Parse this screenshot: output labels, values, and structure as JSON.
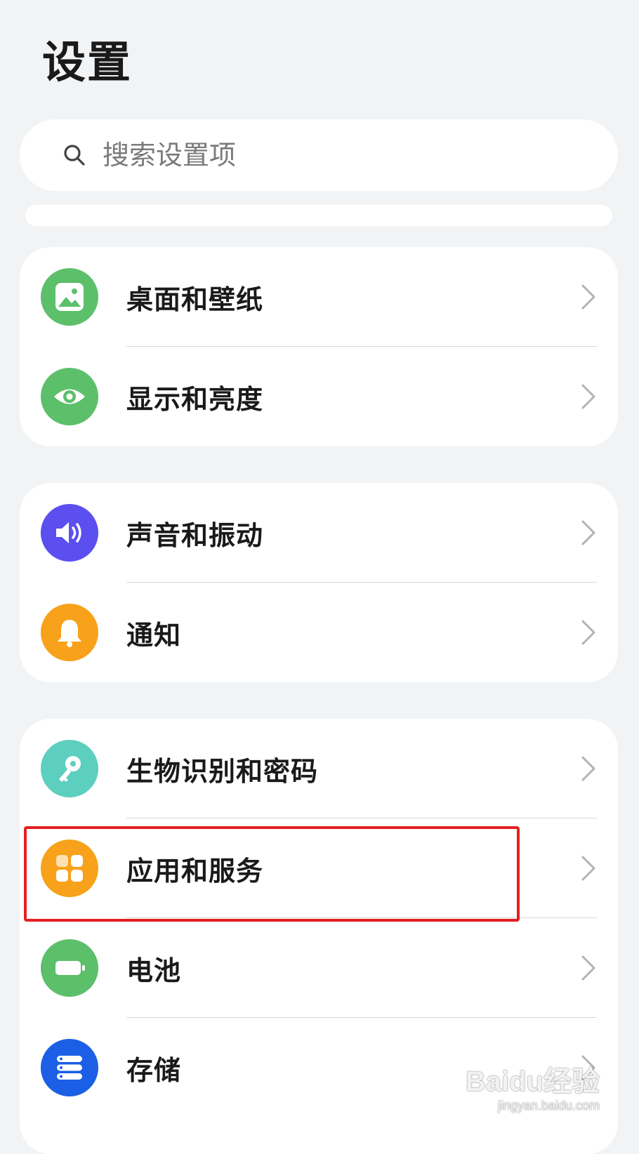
{
  "header": {
    "title": "设置"
  },
  "search": {
    "placeholder": "搜索设置项",
    "icon": "search-icon"
  },
  "groups": [
    {
      "items": [
        {
          "label": "桌面和壁纸",
          "icon": "wallpaper-icon",
          "color": "#5cbf6a"
        },
        {
          "label": "显示和亮度",
          "icon": "eye-icon",
          "color": "#5cbf6a"
        }
      ]
    },
    {
      "items": [
        {
          "label": "声音和振动",
          "icon": "speaker-icon",
          "color": "#5b4ff0"
        },
        {
          "label": "通知",
          "icon": "bell-icon",
          "color": "#f7a21a"
        }
      ]
    },
    {
      "items": [
        {
          "label": "生物识别和密码",
          "icon": "key-icon",
          "color": "#5ccfbe"
        },
        {
          "label": "应用和服务",
          "icon": "apps-grid-icon",
          "color": "#f7a21a"
        },
        {
          "label": "电池",
          "icon": "battery-icon",
          "color": "#5cbf6a"
        },
        {
          "label": "存储",
          "icon": "storage-icon",
          "color": "#1a5fe6"
        }
      ]
    }
  ],
  "annotation": {
    "highlight_color": "#e32020",
    "highlighted_item": "应用和服务"
  },
  "watermark": {
    "brand": "Baidu经验",
    "url": "jingyan.baidu.com"
  }
}
